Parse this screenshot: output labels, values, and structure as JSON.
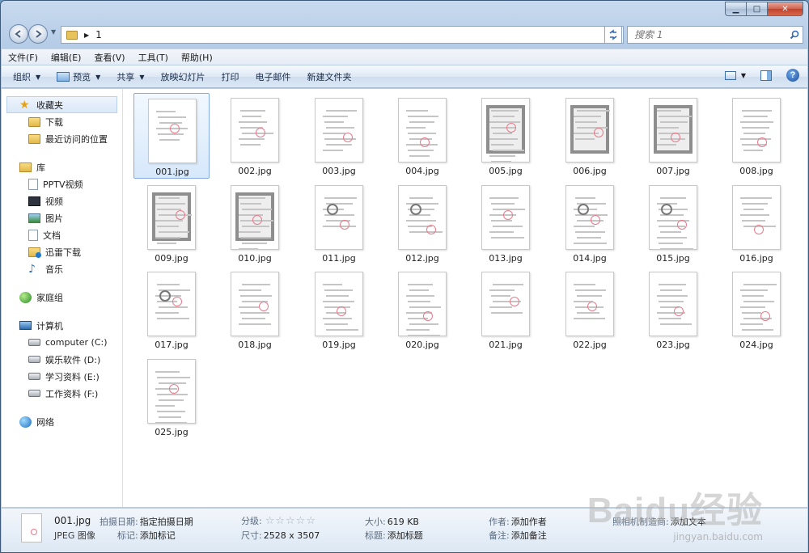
{
  "window": {
    "caption": {
      "minimize": "▁",
      "maximize": "□",
      "close": "✕"
    }
  },
  "address": {
    "path_segment": "1",
    "search_placeholder": "搜索 1"
  },
  "menu": [
    "文件(F)",
    "编辑(E)",
    "查看(V)",
    "工具(T)",
    "帮助(H)"
  ],
  "commands": {
    "organize": "组织",
    "preview": "预览",
    "share": "共享",
    "slideshow": "放映幻灯片",
    "print": "打印",
    "email": "电子邮件",
    "new_folder": "新建文件夹",
    "help": "?"
  },
  "nav": {
    "favorites": {
      "label": "收藏夹",
      "items": [
        "下载",
        "最近访问的位置"
      ]
    },
    "libraries": {
      "label": "库",
      "items": [
        "PPTV视频",
        "视频",
        "图片",
        "文档",
        "迅雷下载",
        "音乐"
      ]
    },
    "homegroup": {
      "label": "家庭组"
    },
    "computer": {
      "label": "计算机",
      "items": [
        "computer (C:)",
        "娱乐软件 (D:)",
        "学习资料 (E:)",
        "工作资料 (F:)"
      ]
    },
    "network": {
      "label": "网络"
    }
  },
  "files": [
    "001.jpg",
    "002.jpg",
    "003.jpg",
    "004.jpg",
    "005.jpg",
    "006.jpg",
    "007.jpg",
    "008.jpg",
    "009.jpg",
    "010.jpg",
    "011.jpg",
    "012.jpg",
    "013.jpg",
    "014.jpg",
    "015.jpg",
    "016.jpg",
    "017.jpg",
    "018.jpg",
    "019.jpg",
    "020.jpg",
    "021.jpg",
    "022.jpg",
    "023.jpg",
    "024.jpg",
    "025.jpg"
  ],
  "selected_file": "001.jpg",
  "details": {
    "name": "001.jpg",
    "type": "JPEG 图像",
    "date_taken_label": "拍摄日期:",
    "date_taken_value": "指定拍摄日期",
    "tags_label": "标记:",
    "tags_value": "添加标记",
    "rating_label": "分级:",
    "rating_value": 0,
    "rating_stars": "☆☆☆☆☆",
    "dimensions_label": "尺寸:",
    "dimensions_value": "2528 x 3507",
    "size_label": "大小:",
    "size_value": "619 KB",
    "title_label": "标题:",
    "title_value": "添加标题",
    "author_label": "作者:",
    "author_value": "添加作者",
    "comments_label": "备注:",
    "comments_value": "添加备注",
    "camera_label": "照相机制造商:",
    "camera_value": "添加文本"
  },
  "watermark": {
    "brand": "Baidu经验",
    "url": "jingyan.baidu.com"
  },
  "colors": {
    "selection_bg": "#d6e8fb",
    "selection_border": "#84acdd",
    "stamp": "#e97a8b"
  }
}
